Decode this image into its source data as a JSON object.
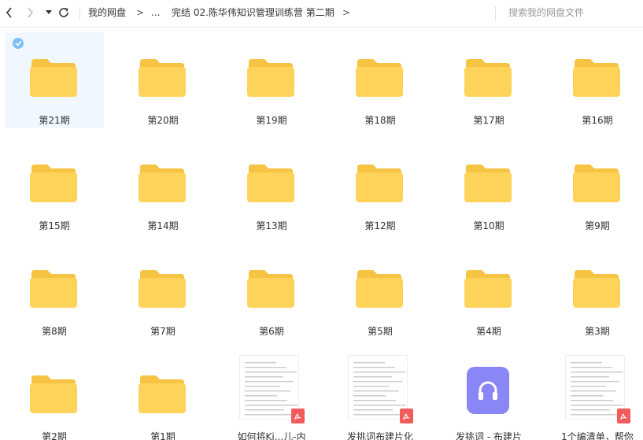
{
  "breadcrumb": {
    "root": "我的网盘",
    "ellipsis": "...",
    "current": "完结 02.陈华伟知识管理训练营 第二期",
    "separator": ">"
  },
  "search": {
    "placeholder": "搜索我的网盘文件"
  },
  "colors": {
    "folder": "#fdd35a",
    "folder_tab": "#f6c343",
    "selected_bg": "#f0f7fe",
    "accent": "#7fbff5",
    "pdf": "#f25b5b",
    "audio": "#8b86f6"
  },
  "items": [
    {
      "label": "第21期",
      "type": "folder",
      "selected": true
    },
    {
      "label": "第20期",
      "type": "folder"
    },
    {
      "label": "第19期",
      "type": "folder"
    },
    {
      "label": "第18期",
      "type": "folder"
    },
    {
      "label": "第17期",
      "type": "folder"
    },
    {
      "label": "第16期",
      "type": "folder"
    },
    {
      "label": "第15期",
      "type": "folder"
    },
    {
      "label": "第14期",
      "type": "folder"
    },
    {
      "label": "第13期",
      "type": "folder"
    },
    {
      "label": "第12期",
      "type": "folder"
    },
    {
      "label": "第10期",
      "type": "folder"
    },
    {
      "label": "第9期",
      "type": "folder"
    },
    {
      "label": "第8期",
      "type": "folder"
    },
    {
      "label": "第7期",
      "type": "folder"
    },
    {
      "label": "第6期",
      "type": "folder"
    },
    {
      "label": "第5期",
      "type": "folder"
    },
    {
      "label": "第4期",
      "type": "folder"
    },
    {
      "label": "第3期",
      "type": "folder"
    },
    {
      "label": "第2期",
      "type": "folder"
    },
    {
      "label": "第1期",
      "type": "folder"
    },
    {
      "label": "如何将Ki...儿-内",
      "type": "pdf"
    },
    {
      "label": "发挑词布建片化",
      "type": "pdf"
    },
    {
      "label": "发挑词 - 布建片",
      "type": "audio"
    },
    {
      "label": "1个编清单，帮你",
      "type": "pdf"
    }
  ]
}
